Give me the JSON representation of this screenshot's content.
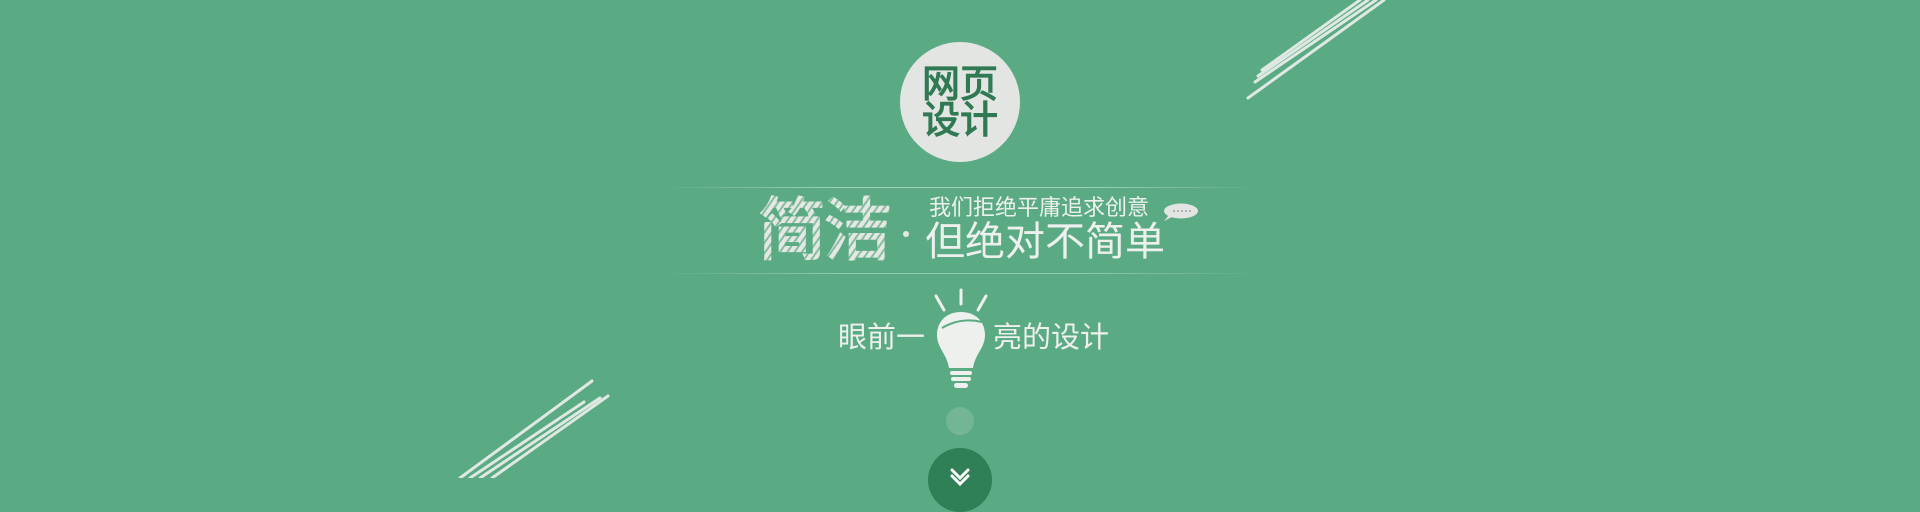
{
  "page": {
    "background": "#5aab83"
  },
  "badge": {
    "line1": "网页",
    "line2": "设计",
    "color": "#2f7a53"
  },
  "headline": {
    "brand": "简洁",
    "separator": "·",
    "small": "我们拒绝平庸追求创意",
    "big": "但绝对不简单"
  },
  "subline": {
    "left": "眼前一",
    "right": "亮的设计"
  },
  "icons": {
    "chat": "chat-bubble-icon",
    "bulb": "lightbulb-icon",
    "down": "chevron-down-icon"
  },
  "colors": {
    "accent_dark": "#2f7f57",
    "text_light": "#eef0ee",
    "badge_bg": "#e3e5e3"
  }
}
